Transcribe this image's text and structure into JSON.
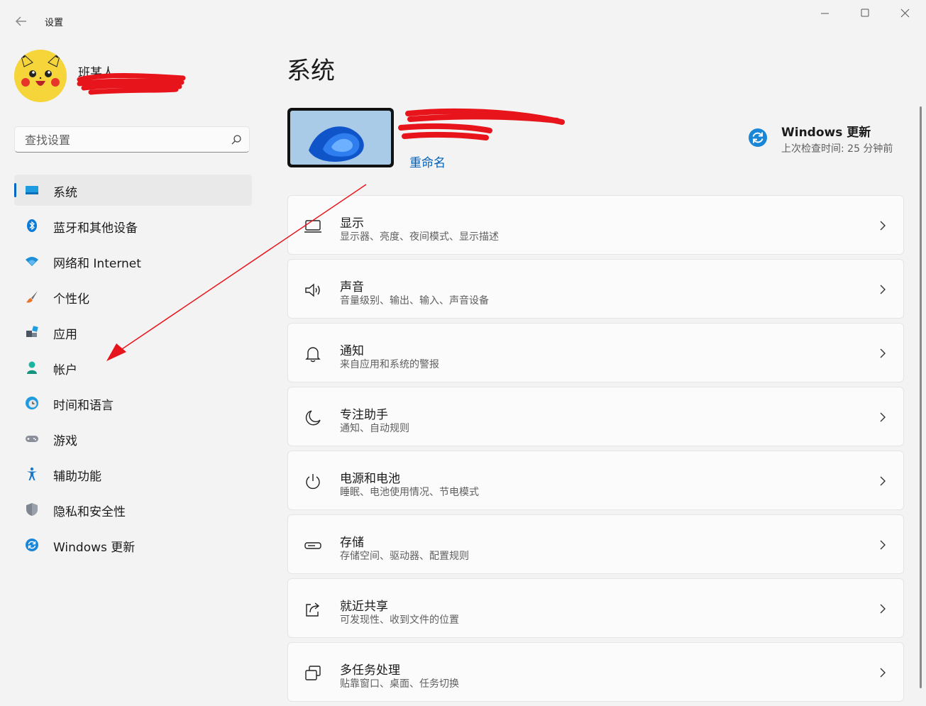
{
  "window": {
    "title": "设置",
    "controls": [
      "minimize-icon",
      "maximize-icon",
      "close-icon"
    ]
  },
  "profile": {
    "name": "班某人"
  },
  "search": {
    "placeholder": "查找设置",
    "value": ""
  },
  "sidebar": {
    "items": [
      {
        "label": "系统",
        "icon": "system-icon",
        "active": true
      },
      {
        "label": "蓝牙和其他设备",
        "icon": "bluetooth-icon"
      },
      {
        "label": "网络和 Internet",
        "icon": "wifi-icon"
      },
      {
        "label": "个性化",
        "icon": "brush-icon"
      },
      {
        "label": "应用",
        "icon": "apps-icon"
      },
      {
        "label": "帐户",
        "icon": "account-icon"
      },
      {
        "label": "时间和语言",
        "icon": "time-language-icon"
      },
      {
        "label": "游戏",
        "icon": "gamepad-icon"
      },
      {
        "label": "辅助功能",
        "icon": "accessibility-icon"
      },
      {
        "label": "隐私和安全性",
        "icon": "shield-icon"
      },
      {
        "label": "Windows 更新",
        "icon": "update-icon"
      }
    ]
  },
  "main": {
    "title": "系统",
    "device": {
      "rename_label": "重命名"
    },
    "update": {
      "title": "Windows 更新",
      "subtitle": "上次检查时间: 25 分钟前"
    },
    "cards": [
      {
        "title": "显示",
        "subtitle": "显示器、亮度、夜间模式、显示描述",
        "icon": "display-icon"
      },
      {
        "title": "声音",
        "subtitle": "音量级别、输出、输入、声音设备",
        "icon": "speaker-icon"
      },
      {
        "title": "通知",
        "subtitle": "来自应用和系统的警报",
        "icon": "bell-icon"
      },
      {
        "title": "专注助手",
        "subtitle": "通知、自动规则",
        "icon": "moon-icon"
      },
      {
        "title": "电源和电池",
        "subtitle": "睡眠、电池使用情况、节电模式",
        "icon": "power-icon"
      },
      {
        "title": "存储",
        "subtitle": "存储空间、驱动器、配置规则",
        "icon": "storage-icon"
      },
      {
        "title": "就近共享",
        "subtitle": "可发现性、收到文件的位置",
        "icon": "share-icon"
      },
      {
        "title": "多任务处理",
        "subtitle": "贴靠窗口、桌面、任务切换",
        "icon": "multitask-icon"
      }
    ]
  },
  "colors": {
    "accent": "#0067c0",
    "link": "#005fb8",
    "annotation": "#e8141c",
    "background": "#f3f3f3",
    "card": "#fbfbfb"
  }
}
